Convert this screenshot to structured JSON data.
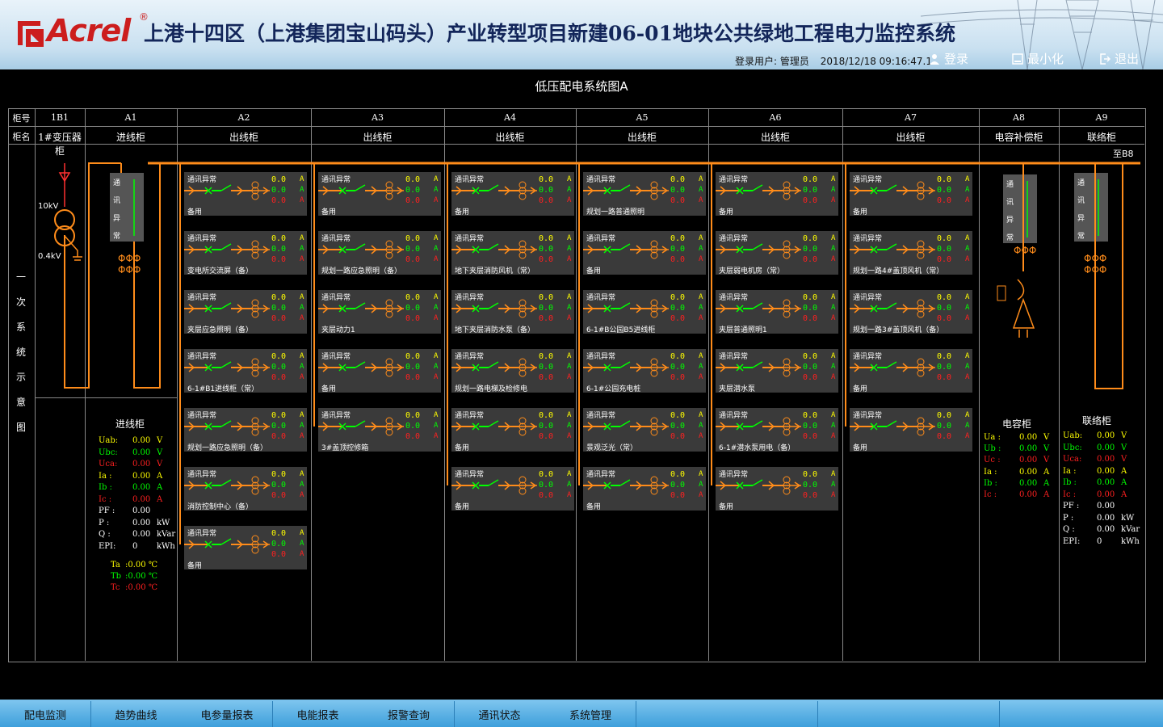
{
  "header": {
    "logo_text": "Acrel",
    "reg_mark": "®",
    "title": "上港十四区（上港集团宝山码头）产业转型项目新建06-01地块公共绿地工程电力监控系统",
    "login_label": "登录用户: 管理员",
    "datetime": "2018/12/18  09:16:47.1",
    "login_btn": "登录",
    "minimize_btn": "最小化",
    "exit_btn": "退出"
  },
  "diagram_title": "低压配电系统图A",
  "row_labels": {
    "cabinet_no": "柜号",
    "cabinet_name": "柜名"
  },
  "columns": [
    {
      "no": "1B1",
      "name": "1#变压器柜"
    },
    {
      "no": "A1",
      "name": "进线柜"
    },
    {
      "no": "A2",
      "name": "出线柜"
    },
    {
      "no": "A3",
      "name": "出线柜"
    },
    {
      "no": "A4",
      "name": "出线柜"
    },
    {
      "no": "A5",
      "name": "出线柜"
    },
    {
      "no": "A6",
      "name": "出线柜"
    },
    {
      "no": "A7",
      "name": "出线柜"
    },
    {
      "no": "A8",
      "name": "电容补偿柜"
    },
    {
      "no": "A9",
      "name": "联络柜"
    }
  ],
  "side_label": [
    "一",
    "次",
    "系",
    "统",
    "示",
    "意",
    "图"
  ],
  "to_b8": "至B8",
  "transformer": {
    "hv": "10kV",
    "lv": "0.4kV"
  },
  "comm_alarm_vertical": [
    "通",
    "讯",
    "异",
    "常"
  ],
  "feeder_status": "通讯异常",
  "feeder_value": "0.0",
  "feeder_unit": "A",
  "feeders": {
    "A2": [
      "备用",
      "变电所交流屏（备）",
      "夹层应急照明（备）",
      "6-1#B1进线柜（常）",
      "规划一路应急照明（备）",
      "消防控制中心（备）",
      "备用"
    ],
    "A3": [
      "备用",
      "规划一路应急照明（备）",
      "夹层动力1",
      "备用",
      "3#盖顶控修箱"
    ],
    "A4": [
      "备用",
      "地下夹层消防风机（常）",
      "地下夹层消防水泵（备）",
      "规划一路电梯及检修电",
      "备用",
      "备用"
    ],
    "A5": [
      "规划一路普通照明",
      "备用",
      "6-1#B公园B5进线柜",
      "6-1#公园充电桩",
      "景观泛光（常）",
      "备用"
    ],
    "A6": [
      "备用",
      "夹层弱电机房（常）",
      "夹层普通照明1",
      "夹层潜水泵",
      "6-1#潜水泵用电（备）",
      "备用"
    ],
    "A7": [
      "备用",
      "规划一路4#盖顶风机（常）",
      "规划一路3#盖顶风机（备）",
      "备用",
      "备用"
    ]
  },
  "incoming_meter": {
    "title": "进线柜",
    "rows": [
      {
        "label": "Uab:",
        "value": "0.00",
        "unit": "V",
        "color": "#ffff00"
      },
      {
        "label": "Ubc:",
        "value": "0.00",
        "unit": "V",
        "color": "#00ff00"
      },
      {
        "label": "Uca:",
        "value": "0.00",
        "unit": "V",
        "color": "#ff2020"
      },
      {
        "label": "Ia  :",
        "value": "0.00",
        "unit": "A",
        "color": "#ffff00"
      },
      {
        "label": "Ib  :",
        "value": "0.00",
        "unit": "A",
        "color": "#00ff00"
      },
      {
        "label": "Ic  :",
        "value": "0.00",
        "unit": "A",
        "color": "#ff2020"
      },
      {
        "label": "PF  :",
        "value": "0.00",
        "unit": "",
        "color": "#ffffff"
      },
      {
        "label": "P   :",
        "value": "0.00",
        "unit": "kW",
        "color": "#ffffff"
      },
      {
        "label": "Q   :",
        "value": "0.00",
        "unit": "kVar",
        "color": "#ffffff"
      },
      {
        "label": "EPI:",
        "value": "0",
        "unit": "kWh",
        "color": "#ffffff"
      }
    ],
    "temps": [
      {
        "label": "Ta",
        "value": ":0.00 ℃",
        "color": "#ffff00"
      },
      {
        "label": "Tb",
        "value": ":0.00 ℃",
        "color": "#00ff00"
      },
      {
        "label": "Tc",
        "value": ":0.00 ℃",
        "color": "#ff2020"
      }
    ]
  },
  "capacitor_meter": {
    "title": "电容柜",
    "rows": [
      {
        "label": "Ua :",
        "value": "0.00",
        "unit": "V",
        "color": "#ffff00"
      },
      {
        "label": "Ub :",
        "value": "0.00",
        "unit": "V",
        "color": "#00ff00"
      },
      {
        "label": "Uc :",
        "value": "0.00",
        "unit": "V",
        "color": "#ff2020"
      },
      {
        "label": "Ia :",
        "value": "0.00",
        "unit": "A",
        "color": "#ffff00"
      },
      {
        "label": "Ib :",
        "value": "0.00",
        "unit": "A",
        "color": "#00ff00"
      },
      {
        "label": "Ic :",
        "value": "0.00",
        "unit": "A",
        "color": "#ff2020"
      }
    ]
  },
  "tie_meter": {
    "title": "联络柜",
    "rows": [
      {
        "label": "Uab:",
        "value": "0.00",
        "unit": "V",
        "color": "#ffff00"
      },
      {
        "label": "Ubc:",
        "value": "0.00",
        "unit": "V",
        "color": "#00ff00"
      },
      {
        "label": "Uca:",
        "value": "0.00",
        "unit": "V",
        "color": "#ff2020"
      },
      {
        "label": "Ia :",
        "value": "0.00",
        "unit": "A",
        "color": "#ffff00"
      },
      {
        "label": "Ib :",
        "value": "0.00",
        "unit": "A",
        "color": "#00ff00"
      },
      {
        "label": "Ic :",
        "value": "0.00",
        "unit": "A",
        "color": "#ff2020"
      },
      {
        "label": "PF :",
        "value": "0.00",
        "unit": "",
        "color": "#ffffff"
      },
      {
        "label": "P  :",
        "value": "0.00",
        "unit": "kW",
        "color": "#ffffff"
      },
      {
        "label": "Q  :",
        "value": "0.00",
        "unit": "kVar",
        "color": "#ffffff"
      },
      {
        "label": "EPI:",
        "value": "0",
        "unit": "kWh",
        "color": "#ffffff"
      }
    ]
  },
  "colors": {
    "bus": "#ff8c1a",
    "feeder_bg": "#3a3a3a",
    "ok": "#00ff00",
    "alarm": "#ff2020",
    "value": "#ffff00"
  },
  "tabs": [
    "配电监测",
    "趋势曲线",
    "电参量报表",
    "电能报表",
    "报警查询",
    "通讯状态",
    "系统管理",
    "",
    "",
    "",
    "",
    "",
    ""
  ]
}
